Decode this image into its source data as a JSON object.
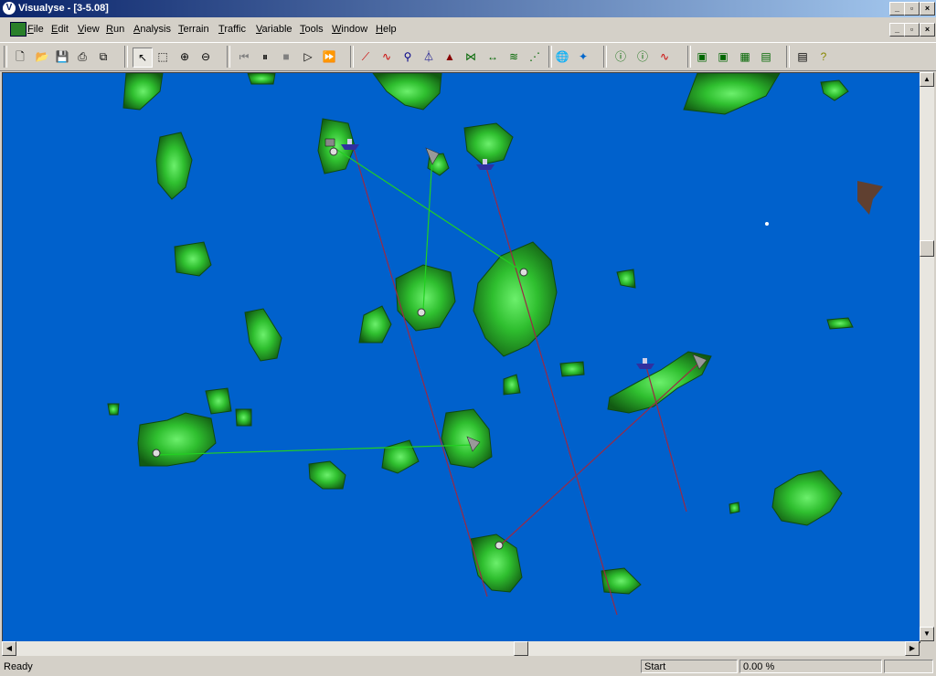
{
  "window": {
    "title": "Visualyse - [3-5.08]"
  },
  "menu": {
    "items": [
      {
        "label": "File",
        "u": "F",
        "rest": "ile"
      },
      {
        "label": "Edit",
        "u": "E",
        "rest": "dit"
      },
      {
        "label": "View",
        "u": "V",
        "rest": "iew"
      },
      {
        "label": "Run",
        "u": "R",
        "rest": "un"
      },
      {
        "label": "Analysis",
        "u": "A",
        "rest": "nalysis"
      },
      {
        "label": "Terrain",
        "u": "T",
        "rest": "errain"
      },
      {
        "label": "Traffic",
        "u": "T",
        "rest": "raffic"
      },
      {
        "label": "Variable",
        "u": "V",
        "rest": "ariable"
      },
      {
        "label": "Tools",
        "u": "T",
        "rest": "ools"
      },
      {
        "label": "Window",
        "u": "W",
        "rest": "indow"
      },
      {
        "label": "Help",
        "u": "H",
        "rest": "elp"
      }
    ]
  },
  "toolbar": {
    "icons": [
      "new-icon",
      "open-icon",
      "save-icon",
      "print-icon",
      "copy-icon",
      "select-arrow-icon",
      "select-region-icon",
      "zoom-in-icon",
      "zoom-out-icon",
      "skip-to-start-icon",
      "pause-icon",
      "stop-icon",
      "play-icon",
      "fast-forward-icon",
      "link-icon",
      "link-wave-icon",
      "station-icon",
      "antenna-icon",
      "terrain-icon",
      "carrier-icon",
      "interference-path-icon",
      "beam-icon",
      "globe-icon",
      "satellite-icon",
      "info-station-icon",
      "info-link-icon",
      "wave-icon",
      "map-view-icon",
      "map-layer-icon",
      "map-grid-icon",
      "map-route-icon",
      "report-icon",
      "help-icon"
    ]
  },
  "colors": {
    "sea": "#0061cc",
    "land_dark": "#1e6a1e",
    "land_light": "#44dd44",
    "link_green": "#22cc22",
    "path_red": "#a02040",
    "landmark_brown": "#604030"
  },
  "statusbar": {
    "message": "Ready",
    "run_state": "Start",
    "progress": "0.00 %"
  }
}
